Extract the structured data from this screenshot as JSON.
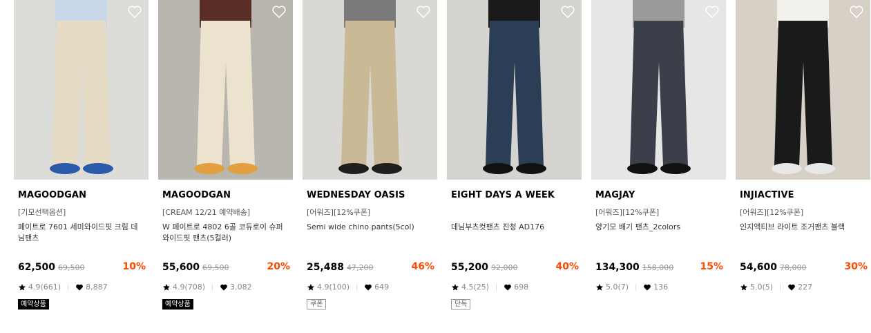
{
  "products": [
    {
      "brand": "MAGOODGAN",
      "tag": "[기모선택옵션]",
      "name": "페이트로 7601 세미와이드핏 크림 데님팬츠",
      "price": "62,500",
      "original": "69,500",
      "discount": "10%",
      "rating": "4.9(661)",
      "likes": "8,887",
      "badge": "예약상품",
      "badge_style": "dark",
      "image": {
        "bg": "#dcdcd8",
        "pants": "#e6dcc6",
        "shoe": "#2a5aa8",
        "top": "#c8d8e8"
      }
    },
    {
      "brand": "MAGOODGAN",
      "tag": "[CREAM 12/21 예약배송]",
      "name": "W 페이트로 4802 6골 코듀로이 슈퍼와이드핏 팬츠(5컬러)",
      "price": "55,600",
      "original": "69,500",
      "discount": "20%",
      "rating": "4.9(708)",
      "likes": "3,082",
      "badge": "예약상품",
      "badge_style": "dark",
      "image": {
        "bg": "#b9b6b0",
        "pants": "#ece3cf",
        "shoe": "#e0a040",
        "top": "#5a2d25"
      }
    },
    {
      "brand": "WEDNESDAY OASIS",
      "tag": "[어워즈][12%쿠폰]",
      "name": "Semi wide chino pants(5col)",
      "price": "25,488",
      "original": "47,200",
      "discount": "46%",
      "rating": "4.9(100)",
      "likes": "649",
      "badge": "쿠폰",
      "badge_style": "outline",
      "image": {
        "bg": "#d9d8d4",
        "pants": "#c9b994",
        "shoe": "#1e1e1e",
        "top": "#7a7a7a"
      }
    },
    {
      "brand": "EIGHT DAYS A WEEK",
      "tag": "",
      "name": "데님부츠컷팬츠 진청 AD176",
      "price": "55,200",
      "original": "92,000",
      "discount": "40%",
      "rating": "4.5(25)",
      "likes": "698",
      "badge": "단독",
      "badge_style": "outline",
      "image": {
        "bg": "#d4d3cf",
        "pants": "#2b3e55",
        "shoe": "#111111",
        "top": "#1a1a1a"
      }
    },
    {
      "brand": "MAGJAY",
      "tag": "[어워즈][12%쿠폰]",
      "name": "양기모 배기 팬츠_2colors",
      "price": "134,300",
      "original": "158,000",
      "discount": "15%",
      "rating": "5.0(7)",
      "likes": "136",
      "badge": "",
      "badge_style": "",
      "image": {
        "bg": "#e6e6e6",
        "pants": "#3a3f49",
        "shoe": "#111111",
        "top": "#9a9a9a"
      }
    },
    {
      "brand": "INJIACTIVE",
      "tag": "[어워즈][12%쿠폰]",
      "name": "인지액티브 라이트 조거팬츠 블랙",
      "price": "54,600",
      "original": "78,000",
      "discount": "30%",
      "rating": "5.0(5)",
      "likes": "227",
      "badge": "",
      "badge_style": "",
      "image": {
        "bg": "#d7d0c6",
        "pants": "#1a1a1a",
        "shoe": "#e8e8e8",
        "top": "#f2f0ea"
      }
    }
  ],
  "colors": {
    "discount": "#ff4800",
    "badge_dark": "#000000"
  },
  "icons": {
    "wishlist": "heart-outline-icon",
    "rating": "star-icon",
    "likes": "heart-filled-icon"
  }
}
